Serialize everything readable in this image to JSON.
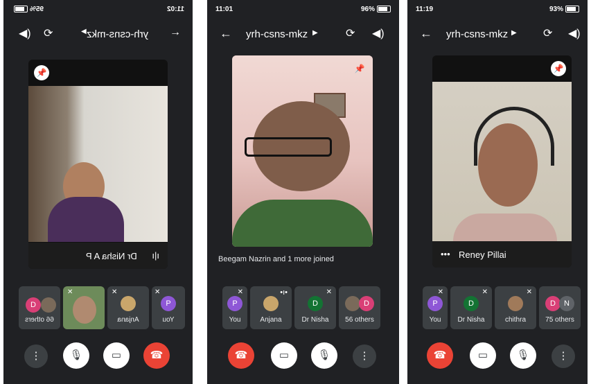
{
  "screens": [
    {
      "status_left": "95%",
      "status_right": "11:02",
      "meeting_code": "yrh-csns-mkz",
      "main_tile_name": "Dr Nisha A P",
      "participants": [
        {
          "label": "You",
          "initial": "P",
          "color": "#8e57d6"
        },
        {
          "label": "Anjana",
          "initial": "",
          "color": "#c9a66b"
        },
        {
          "label": "",
          "initial": "",
          "color": "#6d8b5a"
        },
        {
          "label": "66 others",
          "initial": "D",
          "color": "#d93f76"
        }
      ]
    },
    {
      "status_left": "11:01",
      "status_right": "96%",
      "meeting_code": "yrh-csns-mkz",
      "notice": "Beegam Nazrin and 1 more joined",
      "participants": [
        {
          "label": "You",
          "initial": "P",
          "color": "#8e57d6"
        },
        {
          "label": "Anjana",
          "initial": "",
          "color": "#c9a66b"
        },
        {
          "label": "Dr Nisha",
          "initial": "D",
          "color": "#137333"
        },
        {
          "label": "56 others",
          "initial": "D",
          "color": "#d93f76"
        }
      ]
    },
    {
      "status_left": "11:19",
      "status_right": "93%",
      "meeting_code": "yrh-csns-mkz",
      "main_tile_name": "Reney Pillai",
      "participants": [
        {
          "label": "You",
          "initial": "P",
          "color": "#8e57d6"
        },
        {
          "label": "Dr Nisha",
          "initial": "D",
          "color": "#137333"
        },
        {
          "label": "chithra",
          "initial": "",
          "color": "#a07a5a"
        },
        {
          "label": "75 others",
          "initial": "N",
          "color": "#d93f76"
        }
      ]
    }
  ]
}
